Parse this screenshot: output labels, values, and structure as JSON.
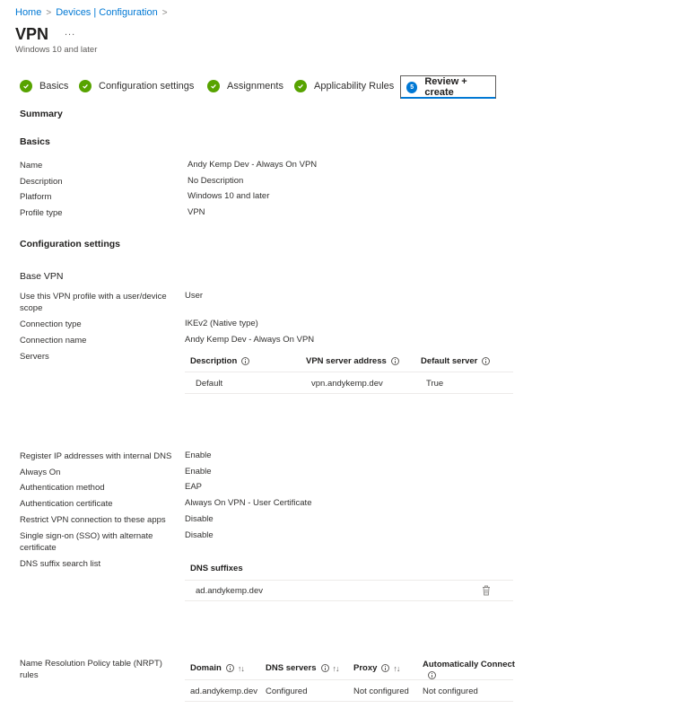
{
  "breadcrumb": {
    "home": "Home",
    "devices": "Devices | Configuration",
    "sep": ">"
  },
  "header": {
    "title": "VPN",
    "more": "...",
    "subtitle": "Windows 10 and later"
  },
  "steps": [
    {
      "label": "Basics",
      "state": "complete"
    },
    {
      "label": "Configuration settings",
      "state": "complete"
    },
    {
      "label": "Assignments",
      "state": "complete"
    },
    {
      "label": "Applicability Rules",
      "state": "complete"
    },
    {
      "label": "Review + create",
      "state": "active",
      "number": "5"
    }
  ],
  "summary": "Summary",
  "basics": {
    "heading": "Basics",
    "rows": [
      {
        "label": "Name",
        "value": "Andy Kemp Dev - Always On VPN"
      },
      {
        "label": "Description",
        "value": "No Description"
      },
      {
        "label": "Platform",
        "value": "Windows 10 and later"
      },
      {
        "label": "Profile type",
        "value": "VPN"
      }
    ]
  },
  "config": {
    "heading": "Configuration settings",
    "base_vpn": "Base VPN",
    "scope_label_1": "Use this VPN profile with a user/device",
    "scope_label_2": "scope",
    "scope_value": "User",
    "connection_type_label": "Connection type",
    "connection_type_value": "IKEv2 (Native type)",
    "connection_name_label": "Connection name",
    "connection_name_value": "Andy Kemp Dev - Always On VPN",
    "servers_label": "Servers",
    "servers_table": {
      "headers": [
        "Description",
        "VPN server address",
        "Default server"
      ],
      "row": [
        "Default",
        "vpn.andykemp.dev",
        "True"
      ]
    },
    "register_ip_label": "Register IP addresses with internal DNS",
    "register_ip_value": "Enable",
    "always_on_label": "Always On",
    "always_on_value": "Enable",
    "auth_method_label": "Authentication method",
    "auth_method_value": "EAP",
    "auth_cert_label": "Authentication certificate",
    "auth_cert_value": "Always On VPN - User Certificate",
    "restrict_label": "Restrict VPN connection to these apps",
    "restrict_value": "Disable",
    "sso_label_1": "Single sign-on (SSO) with alternate",
    "sso_label_2": "certificate",
    "sso_value": "Disable",
    "dns_suffix_label": "DNS suffix search list",
    "dns_table": {
      "header": "DNS suffixes",
      "row": "ad.andykemp.dev"
    },
    "nrpt_label_1": "Name Resolution Policy table (NRPT)",
    "nrpt_label_2": "rules",
    "nrpt_table": {
      "headers": [
        "Domain",
        "DNS servers",
        "Proxy",
        "Automatically Connect"
      ],
      "row": [
        "ad.andykemp.dev",
        "Configured",
        "Not configured",
        "Not configured"
      ]
    }
  }
}
